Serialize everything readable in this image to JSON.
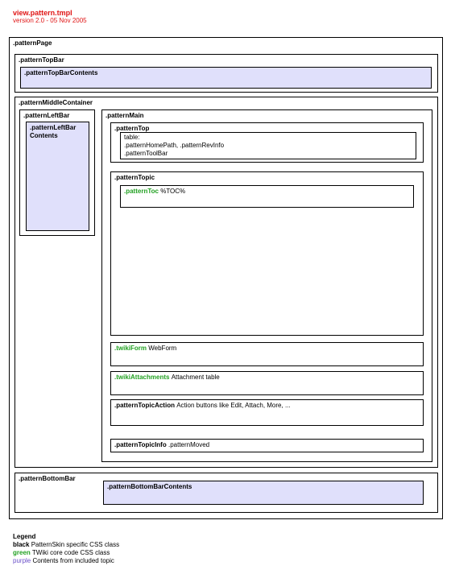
{
  "header": {
    "title": "view.pattern.tmpl",
    "version": "version 2.0 - 05 Nov 2005"
  },
  "boxes": {
    "patternPage": ".patternPage",
    "patternTopBar": ".patternTopBar",
    "patternTopBarContents": ".patternTopBarContents",
    "patternMiddleContainer": ".patternMiddleContainer",
    "patternLeftBar": ".patternLeftBar",
    "patternLeftBarContents_line1": ".patternLeftBar",
    "patternLeftBarContents_line2": "Contents",
    "patternMain": ".patternMain",
    "patternTop": ".patternTop",
    "patternTopTable_line1": "table:",
    "patternTopTable_line2": ".patternHomePath, .patternRevInfo",
    "patternTopTable_line3": ".patternToolBar",
    "patternTopic": ".patternTopic",
    "patternToc": ".patternToc",
    "patternTocRest": "%TOC%",
    "twikiForm": ".twikiForm",
    "twikiFormRest": "WebForm",
    "twikiAttachments": ".twikiAttachments",
    "twikiAttachmentsRest": "Attachment table",
    "patternTopicAction": ".patternTopicAction",
    "patternTopicActionRest": "Action buttons like Edit, Attach, More, ...",
    "patternTopicInfo": ".patternTopicInfo",
    "patternTopicInfoRest": ".patternMoved",
    "patternBottomBar": ".patternBottomBar",
    "patternBottomBarContents": ".patternBottomBarContents"
  },
  "legend": {
    "title": "Legend",
    "black_key": "black",
    "black_desc": "PatternSkin specific CSS class",
    "green_key": "green",
    "green_desc": "TWiki core code CSS class",
    "purple_key": "purple",
    "purple_desc": "Contents from included topic"
  },
  "colors": {
    "title_red": "#e01515",
    "core_green": "#22a122",
    "included_purple": "#e0e0fb",
    "legend_purple": "#6a4fc8"
  }
}
